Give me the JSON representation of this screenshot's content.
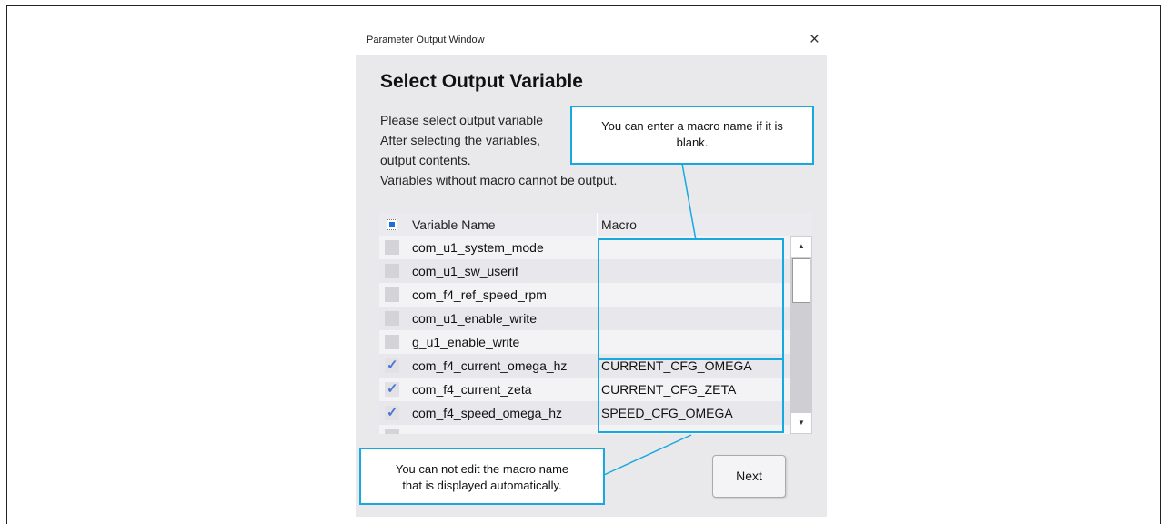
{
  "window": {
    "title": "Parameter Output Window",
    "heading": "Select Output Variable",
    "description": [
      "Please select output variable",
      "After selecting the variables,",
      "output contents.",
      "Variables without macro cannot be output."
    ],
    "next_label": "Next"
  },
  "grid": {
    "columns": [
      "Variable Name",
      "Macro"
    ],
    "select_all_state": "partial",
    "rows": [
      {
        "checked": false,
        "name": "com_u1_system_mode",
        "macro": ""
      },
      {
        "checked": false,
        "name": "com_u1_sw_userif",
        "macro": ""
      },
      {
        "checked": false,
        "name": "com_f4_ref_speed_rpm",
        "macro": ""
      },
      {
        "checked": false,
        "name": "com_u1_enable_write",
        "macro": ""
      },
      {
        "checked": false,
        "name": "g_u1_enable_write",
        "macro": ""
      },
      {
        "checked": true,
        "name": "com_f4_current_omega_hz",
        "macro": "CURRENT_CFG_OMEGA"
      },
      {
        "checked": true,
        "name": "com_f4_current_zeta",
        "macro": "CURRENT_CFG_ZETA"
      },
      {
        "checked": true,
        "name": "com_f4_speed_omega_hz",
        "macro": "SPEED_CFG_OMEGA"
      }
    ]
  },
  "callouts": {
    "top_line1": "You can enter a macro name if it is",
    "top_line2": "blank.",
    "bottom_line1": "You can not edit the macro name",
    "bottom_line2": "that is displayed automatically."
  },
  "colors": {
    "callout_border": "#16a9e0",
    "checkbox_check": "#4a78d0"
  }
}
